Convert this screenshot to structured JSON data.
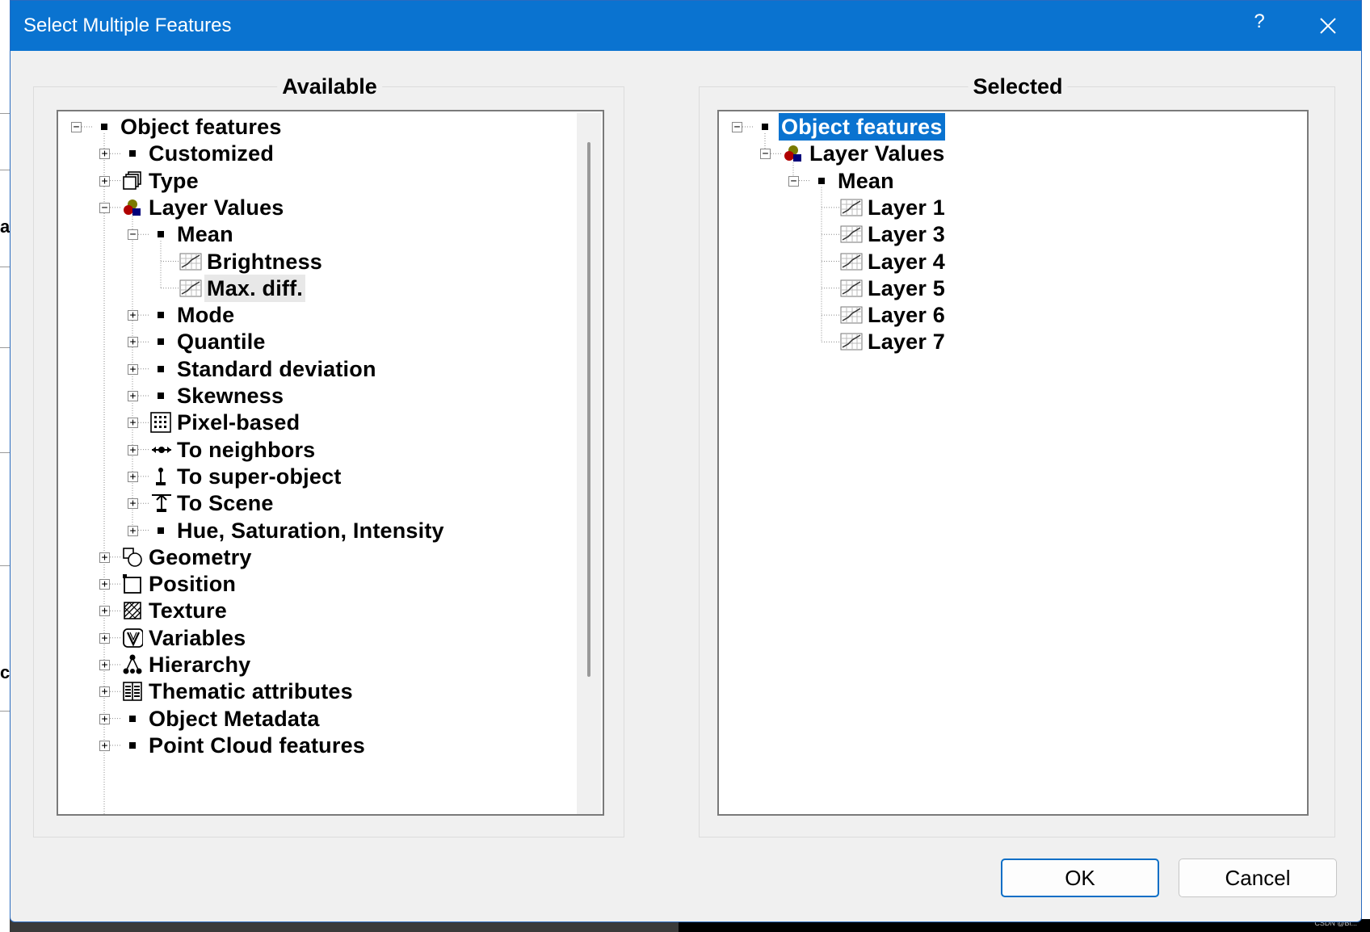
{
  "dialog": {
    "title": "Select Multiple Features",
    "help_label": "?",
    "ok_label": "OK",
    "cancel_label": "Cancel"
  },
  "available": {
    "title": "Available",
    "nodes": [
      {
        "label": "Object features",
        "icon": "square-bullet-icon",
        "expander": "minus"
      },
      {
        "label": "Customized",
        "icon": "square-bullet-icon",
        "expander": "plus"
      },
      {
        "label": "Type",
        "icon": "type-icon",
        "expander": "plus"
      },
      {
        "label": "Layer Values",
        "icon": "layer-values-icon",
        "expander": "minus"
      },
      {
        "label": "Mean",
        "icon": "square-bullet-icon",
        "expander": "minus"
      },
      {
        "label": "Brightness",
        "icon": "feature-chart-icon",
        "expander": "none"
      },
      {
        "label": "Max. diff.",
        "icon": "feature-chart-icon",
        "expander": "none",
        "highlighted": true
      },
      {
        "label": "Mode",
        "icon": "square-bullet-icon",
        "expander": "plus"
      },
      {
        "label": "Quantile",
        "icon": "square-bullet-icon",
        "expander": "plus"
      },
      {
        "label": "Standard deviation",
        "icon": "square-bullet-icon",
        "expander": "plus"
      },
      {
        "label": "Skewness",
        "icon": "square-bullet-icon",
        "expander": "plus"
      },
      {
        "label": "Pixel-based",
        "icon": "pixel-grid-icon",
        "expander": "plus"
      },
      {
        "label": "To neighbors",
        "icon": "neighbors-icon",
        "expander": "plus"
      },
      {
        "label": "To super-object",
        "icon": "super-object-icon",
        "expander": "plus"
      },
      {
        "label": "To Scene",
        "icon": "scene-icon",
        "expander": "plus"
      },
      {
        "label": "Hue, Saturation, Intensity",
        "icon": "square-bullet-icon",
        "expander": "plus"
      },
      {
        "label": "Geometry",
        "icon": "geometry-icon",
        "expander": "plus"
      },
      {
        "label": "Position",
        "icon": "position-icon",
        "expander": "plus"
      },
      {
        "label": "Texture",
        "icon": "texture-icon",
        "expander": "plus"
      },
      {
        "label": "Variables",
        "icon": "variables-icon",
        "expander": "plus"
      },
      {
        "label": "Hierarchy",
        "icon": "hierarchy-icon",
        "expander": "plus"
      },
      {
        "label": "Thematic attributes",
        "icon": "thematic-icon",
        "expander": "plus"
      },
      {
        "label": "Object Metadata",
        "icon": "square-bullet-icon",
        "expander": "plus"
      },
      {
        "label": "Point Cloud features",
        "icon": "square-bullet-icon",
        "expander": "plus"
      }
    ]
  },
  "selected": {
    "title": "Selected",
    "nodes": [
      {
        "label": "Object features",
        "icon": "square-bullet-icon",
        "expander": "minus",
        "selected": true
      },
      {
        "label": "Layer Values",
        "icon": "layer-values-icon",
        "expander": "minus"
      },
      {
        "label": "Mean",
        "icon": "square-bullet-icon",
        "expander": "minus"
      },
      {
        "label": "Layer 1",
        "icon": "feature-chart-icon",
        "expander": "none"
      },
      {
        "label": "Layer 3",
        "icon": "feature-chart-icon",
        "expander": "none"
      },
      {
        "label": "Layer 4",
        "icon": "feature-chart-icon",
        "expander": "none"
      },
      {
        "label": "Layer 5",
        "icon": "feature-chart-icon",
        "expander": "none"
      },
      {
        "label": "Layer 6",
        "icon": "feature-chart-icon",
        "expander": "none"
      },
      {
        "label": "Layer 7",
        "icon": "feature-chart-icon",
        "expander": "none"
      }
    ]
  },
  "background": {
    "fragment_1": "a",
    "fragment_2": "c",
    "watermark": "CSDN @Bi..."
  },
  "colors": {
    "titlebar": "#0a73d0",
    "selection": "#0a73d0",
    "dialog_bg": "#f0f0f0"
  }
}
